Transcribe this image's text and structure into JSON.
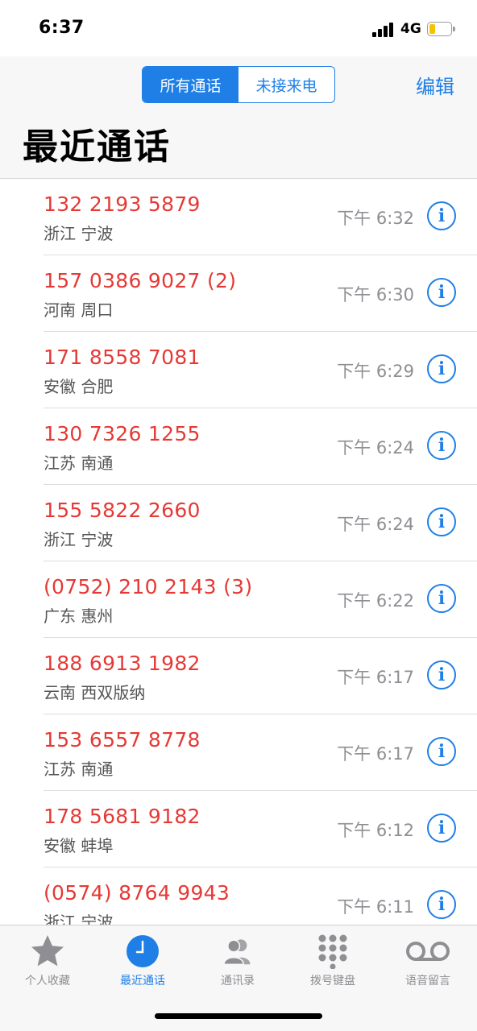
{
  "status": {
    "time": "6:37",
    "network": "4G"
  },
  "header": {
    "segments": [
      {
        "label": "所有通话",
        "active": true
      },
      {
        "label": "未接来电",
        "active": false
      }
    ],
    "edit_label": "编辑",
    "title": "最近通话"
  },
  "calls": [
    {
      "number": "132 2193 5879",
      "location": "浙江 宁波",
      "time": "下午 6:32"
    },
    {
      "number": "157 0386 9027 (2)",
      "location": "河南 周口",
      "time": "下午 6:30"
    },
    {
      "number": "171 8558 7081",
      "location": "安徽 合肥",
      "time": "下午 6:29"
    },
    {
      "number": "130 7326 1255",
      "location": "江苏 南通",
      "time": "下午 6:24"
    },
    {
      "number": "155 5822 2660",
      "location": "浙江 宁波",
      "time": "下午 6:24"
    },
    {
      "number": "(0752) 210 2143 (3)",
      "location": "广东 惠州",
      "time": "下午 6:22"
    },
    {
      "number": "188 6913 1982",
      "location": "云南 西双版纳",
      "time": "下午 6:17"
    },
    {
      "number": "153 6557 8778",
      "location": "江苏 南通",
      "time": "下午 6:17"
    },
    {
      "number": "178 5681 9182",
      "location": "安徽 蚌埠",
      "time": "下午 6:12"
    },
    {
      "number": "(0574) 8764 9943",
      "location": "浙江 宁波",
      "time": "下午 6:11"
    }
  ],
  "tabs": [
    {
      "label": "个人收藏",
      "icon": "star-icon",
      "active": false
    },
    {
      "label": "最近通话",
      "icon": "clock-icon",
      "active": true
    },
    {
      "label": "通讯录",
      "icon": "contacts-icon",
      "active": false
    },
    {
      "label": "拨号键盘",
      "icon": "keypad-icon",
      "active": false
    },
    {
      "label": "语音留言",
      "icon": "voicemail-icon",
      "active": false
    }
  ],
  "colors": {
    "accent": "#1f7fe6",
    "missed": "#e53935",
    "inactive": "#8e8e93"
  }
}
